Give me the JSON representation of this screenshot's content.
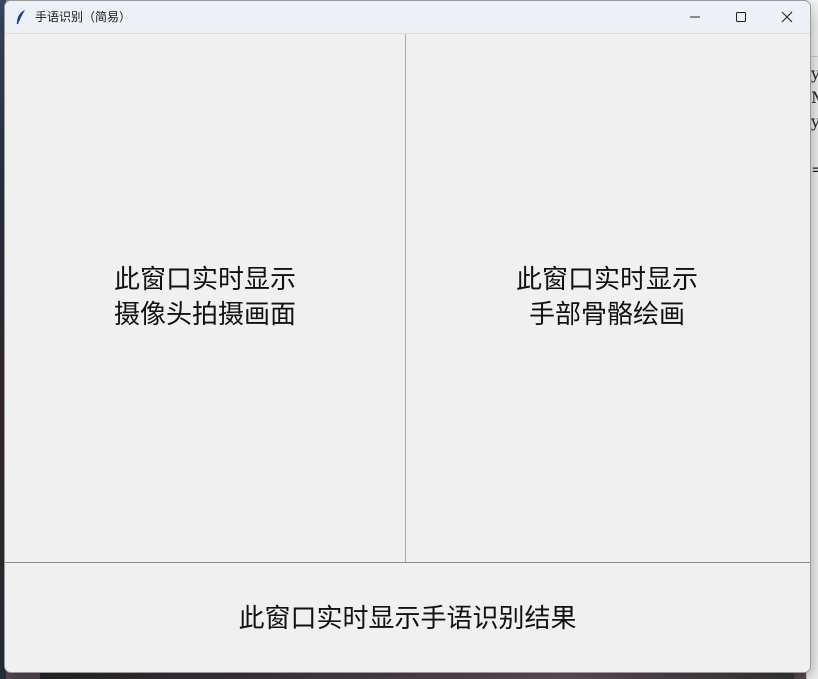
{
  "window": {
    "title": "手语识别（简易）",
    "icon": "feather-icon",
    "controls": [
      "minimize-icon",
      "maximize-icon",
      "close-icon"
    ]
  },
  "panels": {
    "camera": {
      "line1": "此窗口实时显示",
      "line2": "摄像头拍摄画面"
    },
    "skeleton": {
      "line1": "此窗口实时显示",
      "line2": "手部骨骼绘画"
    },
    "result": {
      "text": "此窗口实时显示手语识别结果"
    }
  },
  "background_window": {
    "text_lines": [
      "y",
      "M",
      "y",
      "",
      "="
    ]
  }
}
